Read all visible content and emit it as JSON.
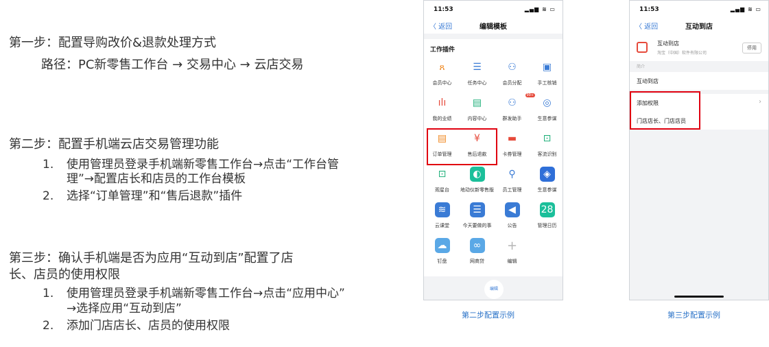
{
  "step1": {
    "title": "第一步：配置导购改价&退款处理方式",
    "path": "路径：PC新零售工作台 → 交易中心 → 云店交易"
  },
  "step2": {
    "title": "第二步：配置手机端云店交易管理功能",
    "items": [
      {
        "num": "1.",
        "line1": "使用管理员登录手机端新零售工作台→点击“工作台管",
        "line2": "理”→配置店长和店员的工作台模板"
      },
      {
        "num": "2.",
        "line1": "选择“订单管理”和“售后退款”插件"
      }
    ]
  },
  "step3": {
    "title_line1": "第三步：确认手机端是否为应用“互动到店”配置了店",
    "title_line2": "长、店员的使用权限",
    "items": [
      {
        "num": "1.",
        "line1": "使用管理员登录手机端新零售工作台→点击“应用中心”",
        "line2": "→选择应用“互动到店”"
      },
      {
        "num": "2.",
        "line1": "添加门店店长、店员的使用权限"
      }
    ]
  },
  "phone1": {
    "time": "11:53",
    "status_icons": "▂▄▆ ≋ ▭",
    "back": "〈 返回",
    "title": "编辑模板",
    "section": "工作插件",
    "plugins": [
      {
        "label": "会员中心",
        "icon": "member-icon",
        "glyph": "ጸ"
      },
      {
        "label": "任务中心",
        "icon": "task-icon",
        "glyph": "☰"
      },
      {
        "label": "会员分配",
        "icon": "assign-icon",
        "glyph": "⚇"
      },
      {
        "label": "手工核销",
        "icon": "writeoff-icon",
        "glyph": "▣"
      },
      {
        "label": "我的业绩",
        "icon": "performance-icon",
        "glyph": "ılı"
      },
      {
        "label": "内容中心",
        "icon": "content-icon",
        "glyph": "▤"
      },
      {
        "label": "群发助手",
        "icon": "broadcast-icon",
        "glyph": "⚇",
        "badge": "99+"
      },
      {
        "label": "生意参谋",
        "icon": "compass-icon",
        "glyph": "◎"
      },
      {
        "label": "订单管理",
        "icon": "order-icon",
        "glyph": "▤"
      },
      {
        "label": "售后退款",
        "icon": "refund-icon",
        "glyph": "¥"
      },
      {
        "label": "卡券管理",
        "icon": "coupon-icon",
        "glyph": "▬"
      },
      {
        "label": "客流识别",
        "icon": "traffic-icon",
        "glyph": "⊡"
      },
      {
        "label": "观星台",
        "icon": "observatory-icon",
        "glyph": "⊡"
      },
      {
        "label": "地动仪新零售版",
        "icon": "seismograph-icon",
        "glyph": "◐"
      },
      {
        "label": "员工管理",
        "icon": "staff-icon",
        "glyph": "⚲"
      },
      {
        "label": "生意参谋",
        "icon": "insight-app-icon",
        "glyph": "◈"
      },
      {
        "label": "云课堂",
        "icon": "cloud-class-icon",
        "glyph": "≋"
      },
      {
        "label": "今天要做的事",
        "icon": "todo-icon",
        "glyph": "☰"
      },
      {
        "label": "公告",
        "icon": "notice-icon",
        "glyph": "◀"
      },
      {
        "label": "管理日历",
        "icon": "calendar-icon",
        "glyph": "28"
      },
      {
        "label": "钉盘",
        "icon": "dingpan-icon",
        "glyph": "☁"
      },
      {
        "label": "网商贷",
        "icon": "loan-icon",
        "glyph": "∞"
      },
      {
        "label": "编辑",
        "icon": "add-icon",
        "glyph": "+"
      }
    ],
    "edit_label": "编辑"
  },
  "phone2": {
    "time": "11:53",
    "status_icons": "▂▄▆ ≋ ▭",
    "back": "〈 返回",
    "title": "互动到店",
    "app_name": "互动到店",
    "app_company": "淘宝（中国）软件有限公司",
    "stop_label": "停用",
    "intro_label": "简介",
    "intro_text": "互动到店",
    "perm_label": "添加权限",
    "roles": "门店店长、门店店员"
  },
  "captions": {
    "phone1": "第二步配置示例",
    "phone2": "第三步配置示例"
  },
  "colors": {
    "accent": "#3a7bd5",
    "caption": "#2b73c8",
    "highlight": "#e0000f"
  }
}
